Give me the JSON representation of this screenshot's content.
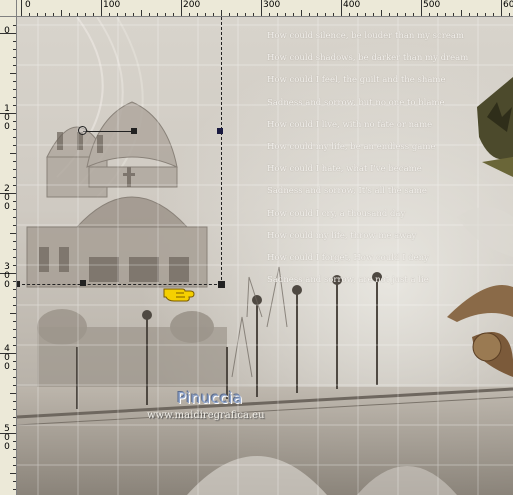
{
  "ruler_top": {
    "labels": [
      "0",
      "100",
      "200",
      "300",
      "400",
      "500",
      "600"
    ]
  },
  "ruler_left": {
    "labels": [
      {
        "digits": [
          "0"
        ]
      },
      {
        "digits": [
          "1",
          "0",
          "0"
        ]
      },
      {
        "digits": [
          "2",
          "0",
          "0"
        ]
      },
      {
        "digits": [
          "3",
          "0",
          "0"
        ]
      },
      {
        "digits": [
          "4",
          "0",
          "0"
        ]
      },
      {
        "digits": [
          "5",
          "0",
          "0"
        ]
      }
    ]
  },
  "poem": {
    "lines": [
      "How could silence, be louder than my scream",
      "How could shadows, be darker than my dream",
      "How could I feel, the guilt and the shame",
      "Sadness and sorrow, but no one to blame",
      "How could I live, with no fate or name",
      "How could my life, be an endless game",
      "How could I hate, what I've became",
      "Sadness and sorrow, It's all the same",
      "How could I cry, a thousand day",
      "How could my life, throw me away",
      "How could I forget, How could I deny",
      "Sadness and sorrow, are not just a lie"
    ]
  },
  "watermark": {
    "name": "Pinuccia",
    "url": "www.maidiregrafica.eu"
  },
  "icons": {
    "cursor": "pointing-hand-cursor-icon",
    "pivot": "rotation-pivot-icon"
  },
  "colors": {
    "selection_line": "#222222",
    "cursor_fill": "#f5d000"
  }
}
